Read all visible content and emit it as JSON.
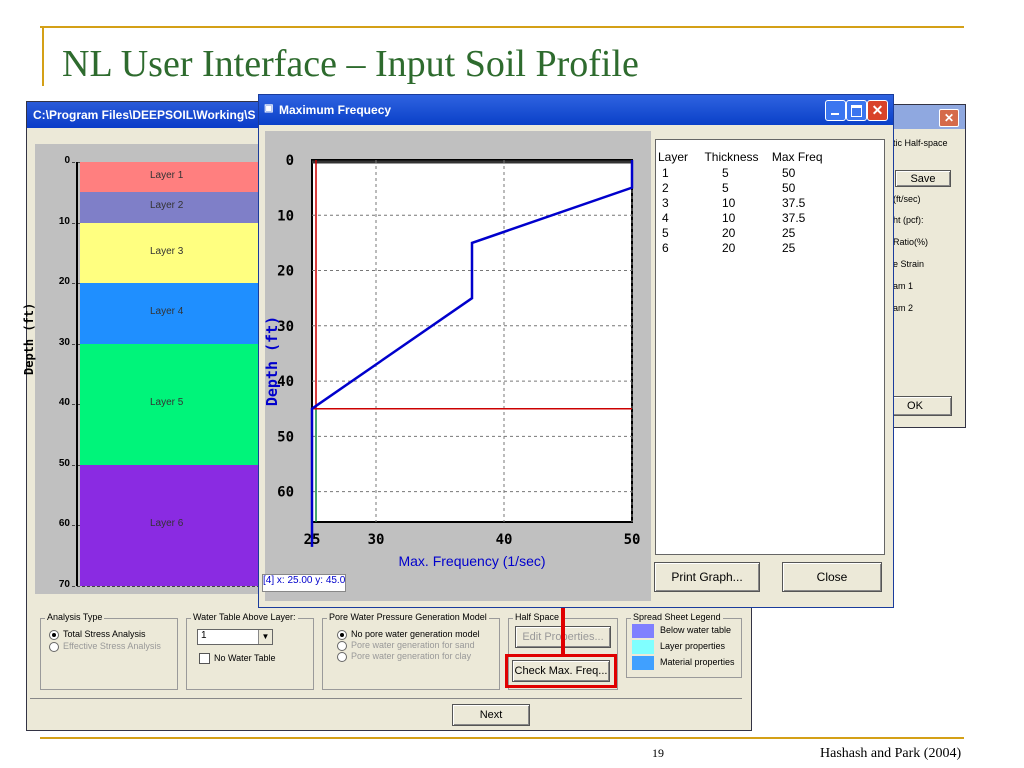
{
  "slide": {
    "title": "NL User Interface – Input Soil Profile",
    "page_number": "19",
    "citation": "Hashash and Park (2004)"
  },
  "back_window": {
    "title": "C:\\Program Files\\DEEPSOIL\\Working\\S",
    "profile": {
      "y_label": "Depth (ft)",
      "ticks": [
        "0",
        "10",
        "20",
        "30",
        "40",
        "50",
        "60",
        "70"
      ],
      "layers": [
        {
          "label": "Layer 1",
          "color": "#ff7f7f"
        },
        {
          "label": "Layer 2",
          "color": "#7f7fc8"
        },
        {
          "label": "Layer 3",
          "color": "#ffff80"
        },
        {
          "label": "Layer 4",
          "color": "#1f8fff"
        },
        {
          "label": "Layer 5",
          "color": "#00f47a"
        },
        {
          "label": "Layer 6",
          "color": "#8a2be2"
        }
      ]
    },
    "analysis_type": {
      "title": "Analysis Type",
      "opt1": "Total Stress Analysis",
      "opt2": "Effective Stress Analysis"
    },
    "water_table": {
      "title": "Water Table Above Layer:",
      "value": "1",
      "no_water": "No Water Table"
    },
    "pore_pressure": {
      "title": "Pore Water Pressure Generation Model",
      "opt1": "No pore water generation model",
      "opt2": "Pore water generation for sand",
      "opt3": "Pore water generation for clay"
    },
    "half_space": {
      "title": "Half Space",
      "edit": "Edit Properties...",
      "check": "Check Max. Freq..."
    },
    "legend": {
      "title": "Spread Sheet Legend",
      "items": [
        {
          "label": "Below water table",
          "color": "#8080ff"
        },
        {
          "label": "Layer properties",
          "color": "#80ffff"
        },
        {
          "label": "Material properties",
          "color": "#40a0ff"
        }
      ]
    },
    "next": "Next"
  },
  "right_window": {
    "labels": [
      "tic Half-space",
      "(ft/sec)",
      "ht (pcf):",
      "Ratio(%)",
      "e Strain",
      "am 1",
      "am 2"
    ],
    "save": "Save",
    "ok": "OK"
  },
  "front_window": {
    "title": "Maximum Frequecy",
    "table": {
      "header": "Layer     Thickness    Max Freq",
      "rows": [
        "1         5          50",
        "2         5          50",
        "3         10         37.5",
        "4         10         37.5",
        "5         20         25",
        "6         20         25"
      ]
    },
    "print": "Print Graph...",
    "close": "Close",
    "status": "[4] x: 25.00  y: 45.0"
  },
  "chart_data": {
    "type": "line",
    "xlabel": "Max. Frequency (1/sec)",
    "ylabel": "Depth (ft)",
    "xlim": [
      25,
      50
    ],
    "ylim": [
      0,
      70
    ],
    "x_ticks": [
      "25",
      "30",
      "40",
      "50"
    ],
    "y_ticks": [
      "0",
      "10",
      "20",
      "30",
      "40",
      "50",
      "60"
    ],
    "series": [
      {
        "values": [
          [
            50,
            0
          ],
          [
            50,
            5
          ],
          [
            37.5,
            15
          ],
          [
            37.5,
            25
          ],
          [
            25,
            45
          ],
          [
            25,
            70
          ]
        ],
        "color": "#0000cc"
      }
    ],
    "hline": {
      "y": 45,
      "color": "#cc0000"
    },
    "vline_left_color": "#cc0000"
  }
}
